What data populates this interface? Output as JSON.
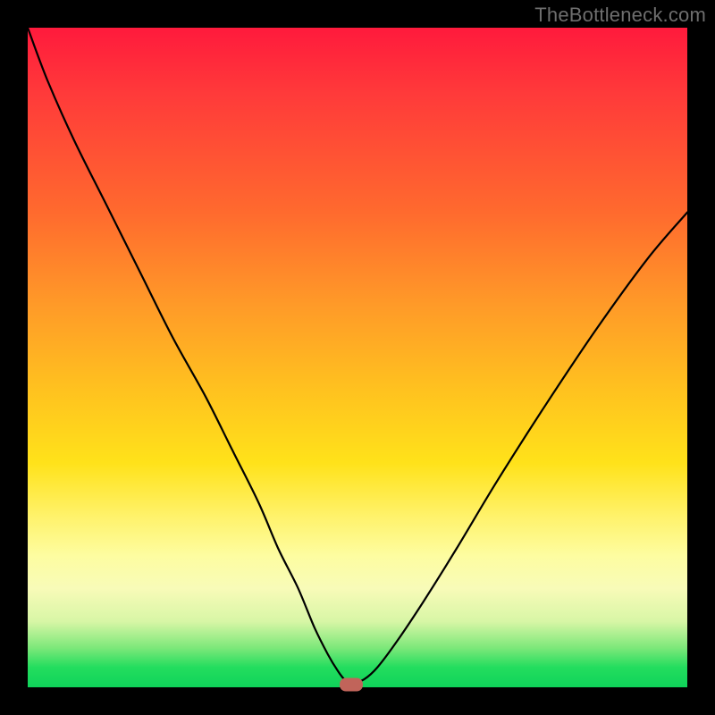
{
  "watermark": "TheBottleneck.com",
  "colors": {
    "frame": "#000000",
    "curve": "#000000",
    "marker": "#c1645a",
    "gradient_top": "#ff1a3c",
    "gradient_bottom": "#0fd35a"
  },
  "chart_data": {
    "type": "line",
    "title": "",
    "xlabel": "",
    "ylabel": "",
    "xlim": [
      0,
      100
    ],
    "ylim": [
      0,
      100
    ],
    "grid": false,
    "legend": false,
    "annotations": [
      {
        "text": "TheBottleneck.com",
        "position": "top-right"
      }
    ],
    "series": [
      {
        "name": "bottleneck-curve",
        "x": [
          0,
          3,
          7,
          12,
          17,
          22,
          27,
          31,
          35,
          38,
          41,
          43.5,
          45.5,
          47,
          48,
          48.7,
          49.3,
          51,
          53,
          56,
          60,
          65,
          71,
          78,
          86,
          94,
          100
        ],
        "y": [
          100,
          92,
          83,
          73,
          63,
          53,
          44,
          36,
          28,
          21,
          15,
          9,
          5,
          2.5,
          1.2,
          0.6,
          0.6,
          1.2,
          3,
          7,
          13,
          21,
          31,
          42,
          54,
          65,
          72
        ]
      }
    ],
    "markers": [
      {
        "name": "optimal-point",
        "x": 49,
        "y": 0.4
      }
    ]
  }
}
